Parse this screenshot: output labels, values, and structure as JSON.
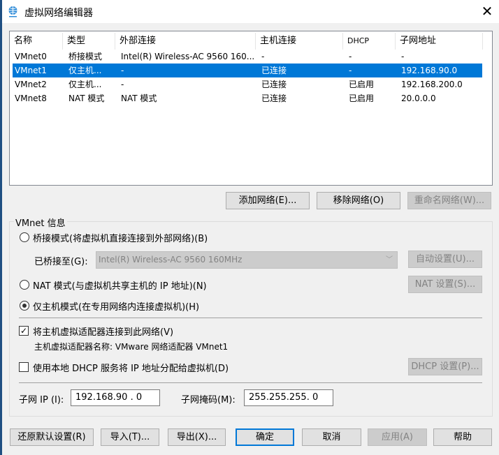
{
  "window": {
    "title": "虚拟网络编辑器",
    "close": "✕"
  },
  "table": {
    "headers": [
      "名称",
      "类型",
      "外部连接",
      "主机连接",
      "DHCP",
      "子网地址"
    ],
    "rows": [
      [
        "VMnet0",
        "桥接模式",
        "Intel(R) Wireless-AC 9560 160...",
        "-",
        "-",
        "-"
      ],
      [
        "VMnet1",
        "仅主机...",
        "-",
        "已连接",
        "-",
        "192.168.90.0"
      ],
      [
        "VMnet2",
        "仅主机...",
        "-",
        "已连接",
        "已启用",
        "192.168.200.0"
      ],
      [
        "VMnet8",
        "NAT 模式",
        "NAT 模式",
        "已连接",
        "已启用",
        "20.0.0.0"
      ]
    ],
    "selected_row": 1
  },
  "list_buttons": {
    "add": "添加网络(E)...",
    "remove": "移除网络(O)",
    "rename": "重命名网络(W)..."
  },
  "info": {
    "group_label": "VMnet 信息",
    "bridged_radio": "桥接模式(将虚拟机直接连接到外部网络)(B)",
    "bridged_to_label": "已桥接至(G):",
    "bridged_to_value": "Intel(R) Wireless-AC 9560 160MHz",
    "auto_button": "自动设置(U)...",
    "nat_radio": "NAT 模式(与虚拟机共享主机的 IP 地址)(N)",
    "nat_button": "NAT 设置(S)...",
    "hostonly_radio": "仅主机模式(在专用网络内连接虚拟机)(H)",
    "selected_mode": "hostonly",
    "connect_adapter": "将主机虚拟适配器连接到此网络(V)",
    "connect_adapter_checked": true,
    "adapter_name": "主机虚拟适配器名称: VMware 网络适配器 VMnet1",
    "dhcp_check": "使用本地 DHCP 服务将 IP 地址分配给虚拟机(D)",
    "dhcp_checked": false,
    "dhcp_button": "DHCP 设置(P)...",
    "subnet_ip_label": "子网 IP (I):",
    "subnet_ip": "192.168.90 . 0",
    "subnet_mask_label": "子网掩码(M):",
    "subnet_mask": "255.255.255. 0"
  },
  "footer": {
    "restore": "还原默认设置(R)",
    "import": "导入(T)...",
    "export": "导出(X)...",
    "ok": "确定",
    "cancel": "取消",
    "apply": "应用(A)",
    "help": "帮助"
  },
  "colors": {
    "selection": "#0078d7",
    "frame": "#1f4f82"
  }
}
